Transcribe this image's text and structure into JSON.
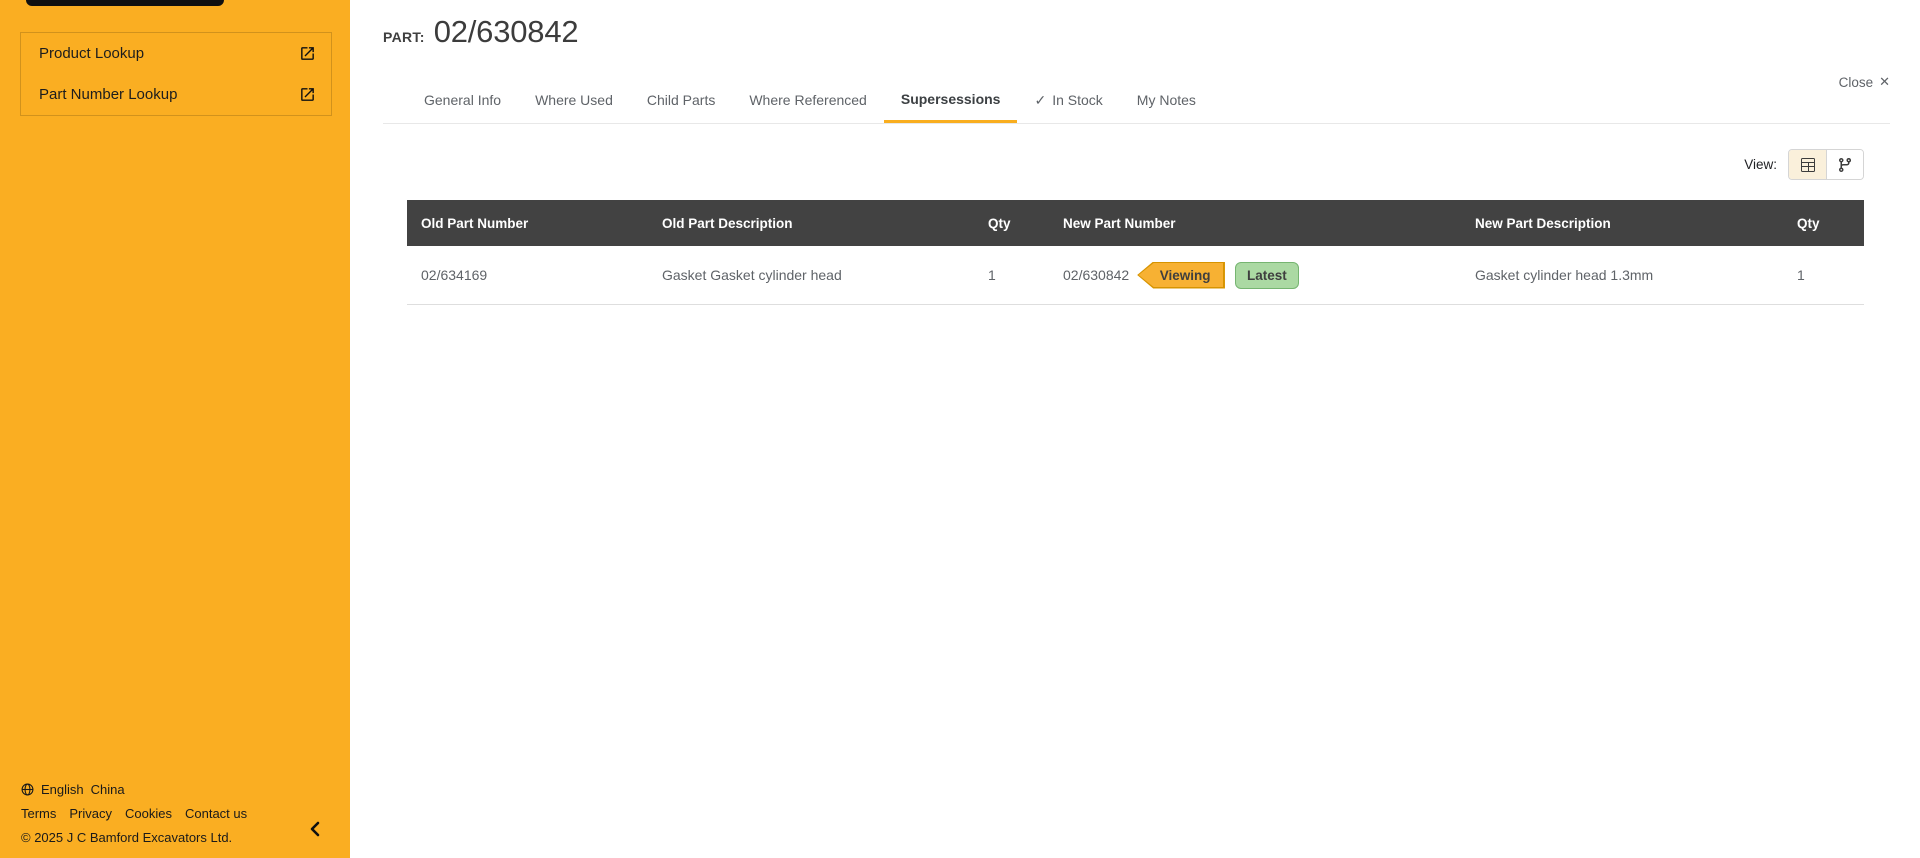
{
  "colors": {
    "sidebar_orange": "#FAAE22",
    "table_header_dark": "#424242",
    "active_tab_underline": "#F9AE1F",
    "viewing_badge_fill": "#F7B133",
    "viewing_badge_border": "#D79400",
    "latest_badge_fill": "#ABD9A3",
    "latest_badge_border": "#76B571"
  },
  "sidebar": {
    "items": [
      {
        "label": "Product Lookup",
        "icon": "open-in-new"
      },
      {
        "label": "Part Number Lookup",
        "icon": "open-in-new"
      }
    ],
    "footer": {
      "language": "English",
      "region": "China",
      "links": [
        "Terms",
        "Privacy",
        "Cookies",
        "Contact us"
      ],
      "copyright": "© 2025 J C Bamford Excavators Ltd."
    }
  },
  "header": {
    "part_label": "PART:",
    "part_number": "02/630842",
    "close_label": "Close"
  },
  "tabs": [
    {
      "label": "General Info"
    },
    {
      "label": "Where Used"
    },
    {
      "label": "Child Parts"
    },
    {
      "label": "Where Referenced"
    },
    {
      "label": "Supersessions",
      "active": true
    },
    {
      "label": "In Stock",
      "icon": "check"
    },
    {
      "label": "My Notes"
    }
  ],
  "view_toggle": {
    "label": "View:",
    "buttons": [
      {
        "name": "table-view",
        "active": true
      },
      {
        "name": "tree-view",
        "active": false
      }
    ]
  },
  "table": {
    "columns": [
      "Old Part Number",
      "Old Part Description",
      "Qty",
      "New Part Number",
      "New Part Description",
      "Qty"
    ],
    "rows": [
      {
        "old_part_number": "02/634169",
        "old_part_description": "Gasket Gasket cylinder head",
        "old_qty": "1",
        "new_part_number": "02/630842",
        "badges": [
          {
            "label": "Viewing",
            "type": "viewing"
          },
          {
            "label": "Latest",
            "type": "latest"
          }
        ],
        "new_part_description": "Gasket cylinder head 1.3mm",
        "new_qty": "1"
      }
    ]
  },
  "icons": {
    "check": "✓",
    "close": "✕"
  }
}
